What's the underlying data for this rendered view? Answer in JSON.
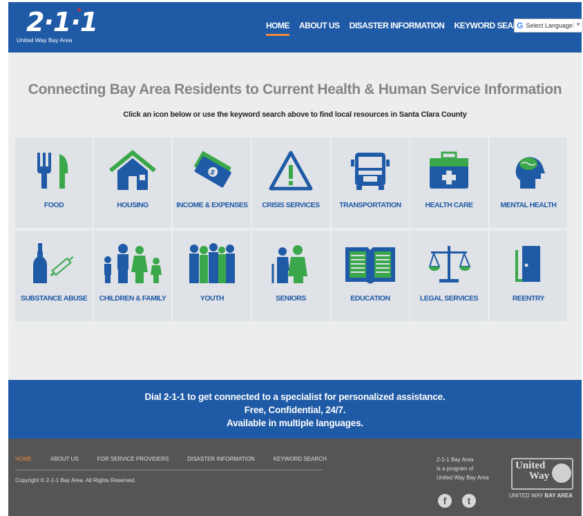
{
  "header": {
    "logo_number": "2·1·1",
    "logo_subtitle": "United Way Bay Area",
    "nav": [
      "HOME",
      "ABOUT US",
      "DISASTER INFORMATION",
      "KEYWORD SEARCH"
    ],
    "language_select": "Select Language",
    "google_glyph": "G"
  },
  "main": {
    "headline": "Connecting Bay Area Residents to Current Health & Human Service Information",
    "subline": "Click an icon below or use the keyword search above to find local resources in Santa Clara County",
    "categories": [
      {
        "label": "FOOD",
        "icon": "fork-knife-icon"
      },
      {
        "label": "HOUSING",
        "icon": "house-icon"
      },
      {
        "label": "INCOME & EXPENSES",
        "icon": "money-icon"
      },
      {
        "label": "CRISIS SERVICES",
        "icon": "warning-icon"
      },
      {
        "label": "TRANSPORTATION",
        "icon": "bus-icon"
      },
      {
        "label": "HEALTH CARE",
        "icon": "medical-kit-icon"
      },
      {
        "label": "MENTAL HEALTH",
        "icon": "brain-head-icon"
      },
      {
        "label": "SUBSTANCE ABUSE",
        "icon": "bottle-syringe-icon"
      },
      {
        "label": "CHILDREN & FAMILY",
        "icon": "family-icon"
      },
      {
        "label": "YOUTH",
        "icon": "youth-group-icon"
      },
      {
        "label": "SENIORS",
        "icon": "seniors-icon"
      },
      {
        "label": "EDUCATION",
        "icon": "book-icon"
      },
      {
        "label": "LEGAL SERVICES",
        "icon": "scales-icon"
      },
      {
        "label": "REENTRY",
        "icon": "door-icon"
      }
    ]
  },
  "banner": {
    "line1": "Dial 2-1-1 to get connected to a specialist for personalized assistance.",
    "line2": "Free, Confidential, 24/7.",
    "line3": "Available in multiple languages."
  },
  "footer": {
    "nav": [
      "HOME",
      "ABOUT US",
      "FOR SERVICE PROVIDERS",
      "DISASTER INFORMATION",
      "KEYWORD SEARCH"
    ],
    "copyright": "Copyright © 2-1-1 Bay Area. All Rights Reserved.",
    "program_lines": [
      "2-1-1 Bay Area",
      "is a program of",
      "United Way Bay Area"
    ],
    "uw_logo_line1": "United",
    "uw_logo_line2": "Way",
    "uw_caption_a": "UNITED WAY ",
    "uw_caption_b": "BAY AREA",
    "social_facebook_glyph": "f",
    "social_twitter_glyph": "t"
  },
  "colors": {
    "brand_blue": "#1f5aa6",
    "icon_blue": "#1f5aa6",
    "icon_green": "#3aa84a",
    "accent_orange": "#f08a3c",
    "tile_bg": "#dfe2e6",
    "footer_bg": "#555555"
  }
}
